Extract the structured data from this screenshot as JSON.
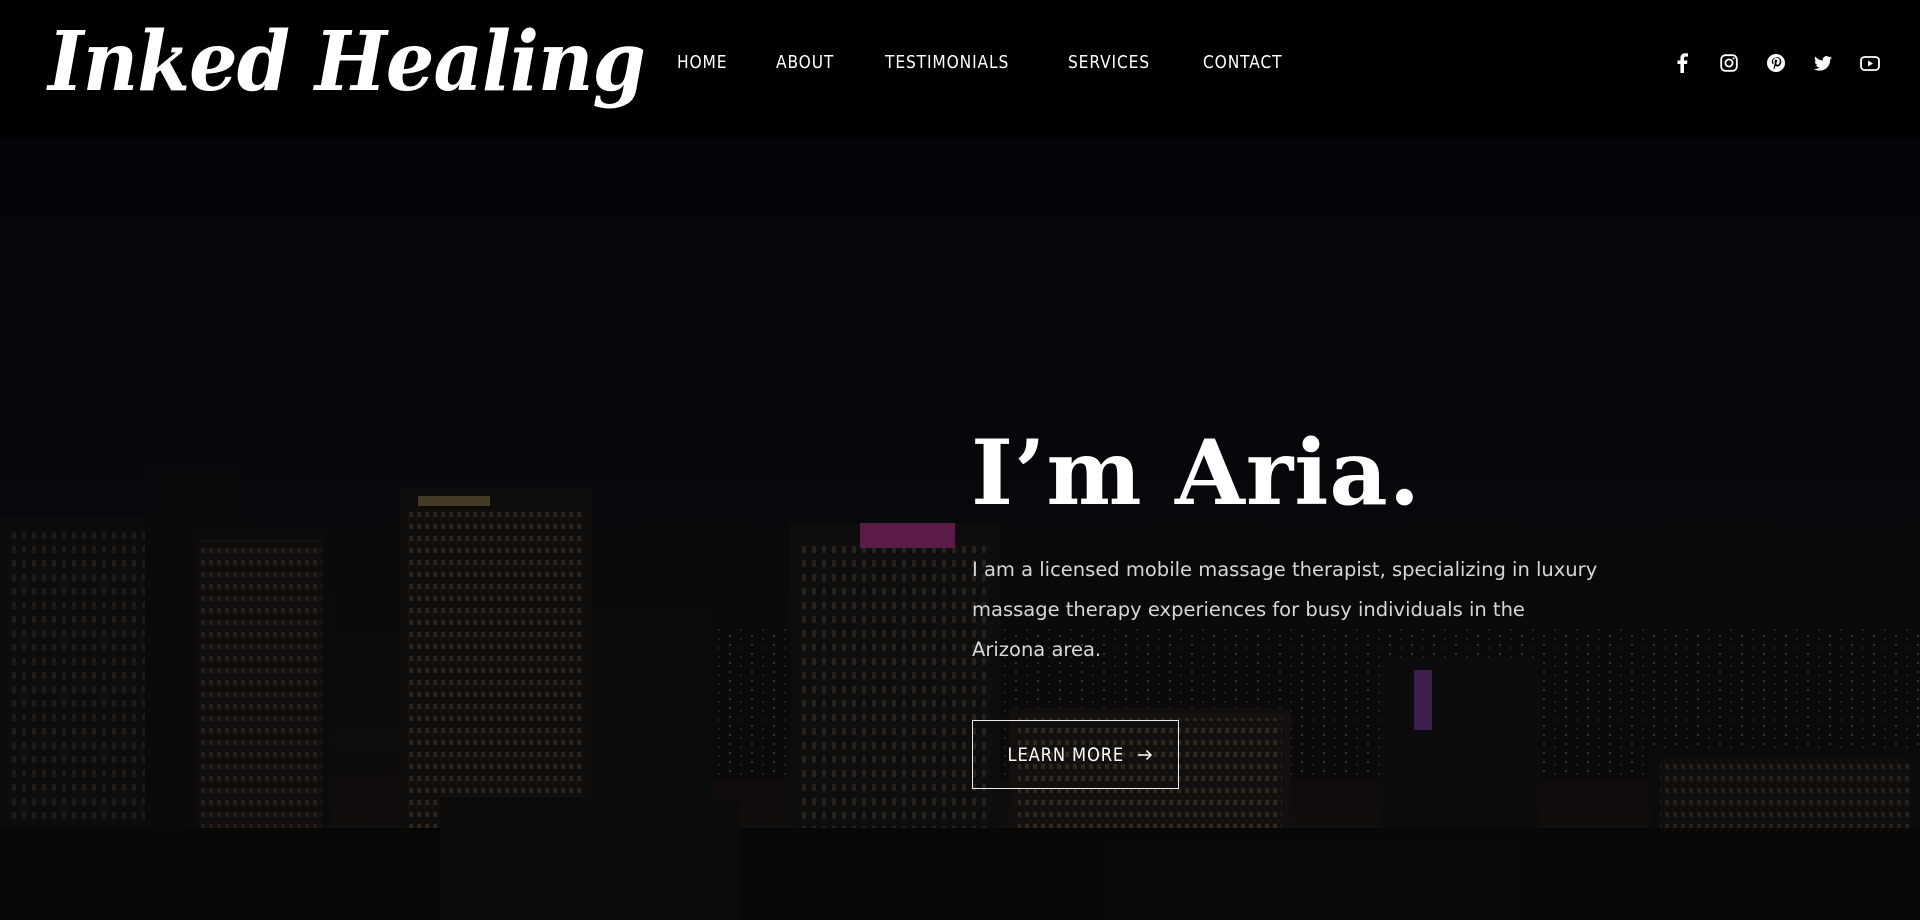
{
  "header": {
    "logo_text": "Inked Healing",
    "nav": [
      {
        "label": "HOME"
      },
      {
        "label": "ABOUT"
      },
      {
        "label": "TESTIMONIALS"
      },
      {
        "label": "SERVICES"
      },
      {
        "label": "CONTACT"
      }
    ],
    "social_icons": [
      "facebook-icon",
      "instagram-icon",
      "pinterest-icon",
      "twitter-icon",
      "youtube-icon"
    ]
  },
  "hero": {
    "title": "I’m Aria.",
    "description": "I am a licensed mobile massage therapist, specializing in luxury massage therapy experiences for busy individuals in the Arizona area.",
    "cta_label": "LEARN MORE",
    "cta_icon": "arrow-right-icon",
    "background": "night city skyline photograph"
  },
  "colors": {
    "header_bg": "#000000",
    "hero_bg": "#070a10",
    "text": "#ffffff",
    "body_text": "#d7d7d7"
  }
}
